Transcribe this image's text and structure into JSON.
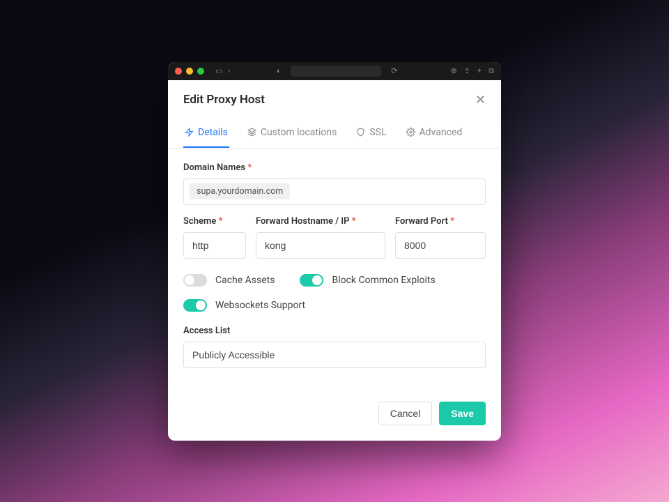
{
  "modal": {
    "title": "Edit Proxy Host"
  },
  "tabs": {
    "details": "Details",
    "custom_locations": "Custom locations",
    "ssl": "SSL",
    "advanced": "Advanced"
  },
  "form": {
    "domain_names": {
      "label": "Domain Names",
      "value": "supa.yourdomain.com"
    },
    "scheme": {
      "label": "Scheme",
      "value": "http"
    },
    "forward_hostname": {
      "label": "Forward Hostname / IP",
      "value": "kong"
    },
    "forward_port": {
      "label": "Forward Port",
      "value": "8000"
    },
    "cache_assets": {
      "label": "Cache Assets",
      "on": false
    },
    "block_exploits": {
      "label": "Block Common Exploits",
      "on": true
    },
    "websockets": {
      "label": "Websockets Support",
      "on": true
    },
    "access_list": {
      "label": "Access List",
      "value": "Publicly Accessible"
    }
  },
  "footer": {
    "cancel": "Cancel",
    "save": "Save"
  },
  "colors": {
    "accent_blue": "#2176ff",
    "accent_teal": "#1cc9a8",
    "required_red": "#e74c3c"
  }
}
